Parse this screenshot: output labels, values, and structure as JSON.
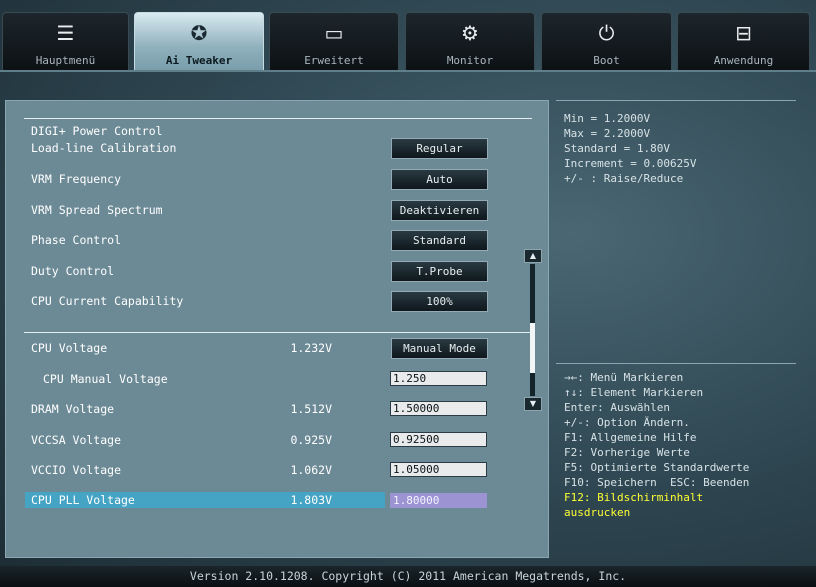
{
  "tabs": [
    {
      "label": "Hauptmenü",
      "icon": "list-icon",
      "active": false
    },
    {
      "label": "Ai Tweaker",
      "icon": "tweaker-icon",
      "active": true
    },
    {
      "label": "Erweitert",
      "icon": "advanced-icon",
      "active": false
    },
    {
      "label": "Monitor",
      "icon": "monitor-icon",
      "active": false
    },
    {
      "label": "Boot",
      "icon": "power-icon",
      "active": false
    },
    {
      "label": "Anwendung",
      "icon": "tool-icon",
      "active": false
    }
  ],
  "section_title": "DIGI+ Power Control",
  "settings": [
    {
      "label": "Load-line Calibration",
      "button": "Regular"
    },
    {
      "label": "VRM Frequency",
      "button": "Auto"
    },
    {
      "label": "VRM Spread Spectrum",
      "button": "Deaktivieren"
    },
    {
      "label": "Phase Control",
      "button": "Standard"
    },
    {
      "label": "Duty Control",
      "button": "T.Probe"
    },
    {
      "label": "CPU Current Capability",
      "button": "100%"
    }
  ],
  "voltages": [
    {
      "label": "CPU Voltage",
      "value": "1.232V",
      "button": "Manual Mode"
    },
    {
      "label": "CPU Manual Voltage",
      "value": "",
      "input": "1.250"
    },
    {
      "label": "DRAM Voltage",
      "value": "1.512V",
      "input": "1.50000"
    },
    {
      "label": "VCCSA Voltage",
      "value": "0.925V",
      "input": "0.92500"
    },
    {
      "label": "VCCIO Voltage",
      "value": "1.062V",
      "input": "1.05000"
    },
    {
      "label": "CPU PLL Voltage",
      "value": "1.803V",
      "input": "1.80000",
      "selected": true
    }
  ],
  "help": {
    "lines": [
      "Min = 1.2000V",
      "Max = 2.2000V",
      "Standard = 1.80V",
      "Increment = 0.00625V",
      "+/- : Raise/Reduce"
    ]
  },
  "keys": {
    "lines": [
      "→←: Menü Markieren",
      "↑↓: Element Markieren",
      "Enter: Auswählen",
      "+/-: Option Ändern.",
      "F1: Allgemeine Hilfe",
      "F2: Vorherige Werte",
      "F5: Optimierte Standardwerte",
      "F10: Speichern  ESC: Beenden"
    ],
    "highlight": [
      "F12: Bildschirminhalt",
      "ausdrucken"
    ]
  },
  "footer": "Version 2.10.1208. Copyright (C) 2011 American Megatrends, Inc."
}
